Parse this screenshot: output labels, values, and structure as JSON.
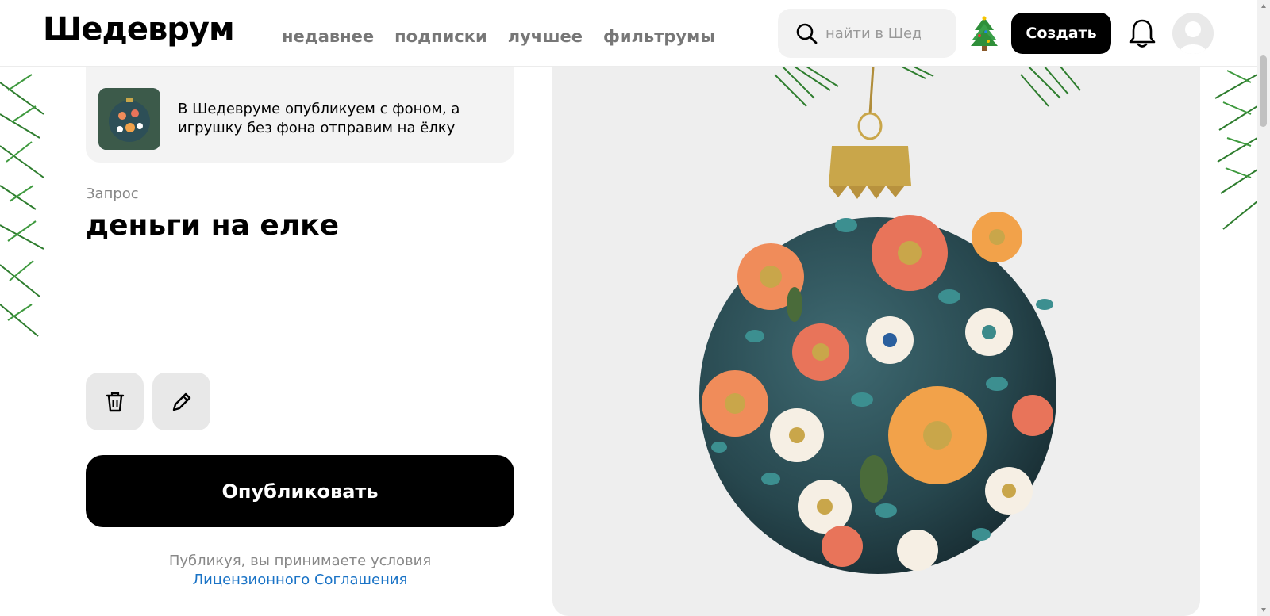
{
  "header": {
    "logo": "Шедеврум",
    "nav": [
      "недавнее",
      "подписки",
      "лучшее",
      "фильтрумы"
    ],
    "search_placeholder": "найти в Шедеврум",
    "create_label": "Создать"
  },
  "notice": {
    "text": "В Шедевруме опубликуем с фоном, а игрушку без фона отправим на ёлку"
  },
  "query": {
    "label": "Запрос",
    "text": "деньги на елке"
  },
  "actions": {
    "publish_label": "Опубликовать",
    "terms_text": "Публикуя, вы принимаете условия",
    "terms_link": "Лицензионного Соглашения"
  },
  "icons": {
    "search": "search-icon",
    "tree": "christmas-tree-icon",
    "bell": "bell-icon",
    "avatar": "avatar-icon",
    "delete": "trash-icon",
    "edit": "pencil-icon"
  },
  "colors": {
    "accent": "#000000",
    "link": "#1a73c6",
    "muted": "#888888"
  }
}
